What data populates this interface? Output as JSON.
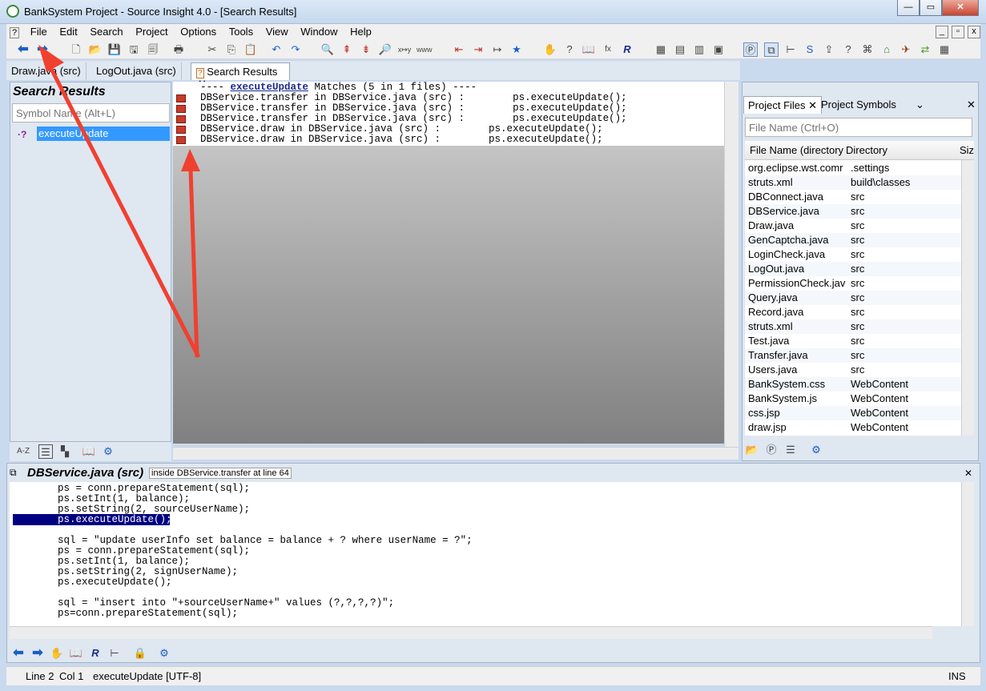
{
  "window": {
    "title": "BankSystem Project - Source Insight 4.0 - [Search Results]"
  },
  "menu": [
    "File",
    "Edit",
    "Search",
    "Project",
    "Options",
    "Tools",
    "View",
    "Window",
    "Help"
  ],
  "tabs": [
    {
      "label": "Draw.java (src)"
    },
    {
      "label": "LogOut.java (src)"
    },
    {
      "label": "Search Results"
    }
  ],
  "search_panel": {
    "title": "Search Results",
    "placeholder": "Symbol Name (Alt+L)",
    "item": "executeUpdate"
  },
  "results": {
    "header_pre": "---- ",
    "header_kw": "executeUpdate",
    "header_post": " Matches (5 in 1 files) ----",
    "lines": [
      "DBService.transfer in DBService.java (src) :        ps.executeUpdate();",
      "DBService.transfer in DBService.java (src) :        ps.executeUpdate();",
      "DBService.transfer in DBService.java (src) :        ps.executeUpdate();",
      "DBService.draw in DBService.java (src) :        ps.executeUpdate();",
      "DBService.draw in DBService.java (src) :        ps.executeUpdate();"
    ]
  },
  "project_files": {
    "tab_files": "Project Files",
    "tab_symbols": "Project Symbols",
    "placeholder": "File Name (Ctrl+O)",
    "col_name": "File Name (directory",
    "col_dir": "Directory",
    "col_size": "Siz",
    "rows": [
      {
        "name": "org.eclipse.wst.comr",
        "dir": ".settings"
      },
      {
        "name": "struts.xml",
        "dir": "build\\classes"
      },
      {
        "name": "DBConnect.java",
        "dir": "src"
      },
      {
        "name": "DBService.java",
        "dir": "src"
      },
      {
        "name": "Draw.java",
        "dir": "src"
      },
      {
        "name": "GenCaptcha.java",
        "dir": "src"
      },
      {
        "name": "LoginCheck.java",
        "dir": "src"
      },
      {
        "name": "LogOut.java",
        "dir": "src"
      },
      {
        "name": "PermissionCheck.jav",
        "dir": "src"
      },
      {
        "name": "Query.java",
        "dir": "src"
      },
      {
        "name": "Record.java",
        "dir": "src"
      },
      {
        "name": "struts.xml",
        "dir": "src"
      },
      {
        "name": "Test.java",
        "dir": "src"
      },
      {
        "name": "Transfer.java",
        "dir": "src"
      },
      {
        "name": "Users.java",
        "dir": "src"
      },
      {
        "name": "BankSystem.css",
        "dir": "WebContent"
      },
      {
        "name": "BankSystem.js",
        "dir": "WebContent"
      },
      {
        "name": "css.jsp",
        "dir": "WebContent"
      },
      {
        "name": "draw.jsp",
        "dir": "WebContent"
      }
    ]
  },
  "code_panel": {
    "title": "DBService.java (src)",
    "context": "inside DBService.transfer at line 64",
    "lines": [
      "ps = conn.prepareStatement(sql);",
      "ps.setInt(1, balance);",
      "ps.setString(2, sourceUserName);",
      "ps.executeUpdate();",
      "",
      "sql = \"update userInfo set balance = balance + ? where userName = ?\";",
      "ps = conn.prepareStatement(sql);",
      "ps.setInt(1, balance);",
      "ps.setString(2, signUserName);",
      "ps.executeUpdate();",
      "",
      "sql = \"insert into \"+sourceUserName+\" values (?,?,?,?)\";",
      "ps=conn.prepareStatement(sql);"
    ]
  },
  "status": {
    "line": "Line 2",
    "col": "Col 1",
    "symbol": "executeUpdate [UTF-8]",
    "mode": "INS"
  },
  "colors": {
    "annotation_arrow": "#f04030",
    "selection": "#3399ff",
    "highlight": "#000080"
  }
}
